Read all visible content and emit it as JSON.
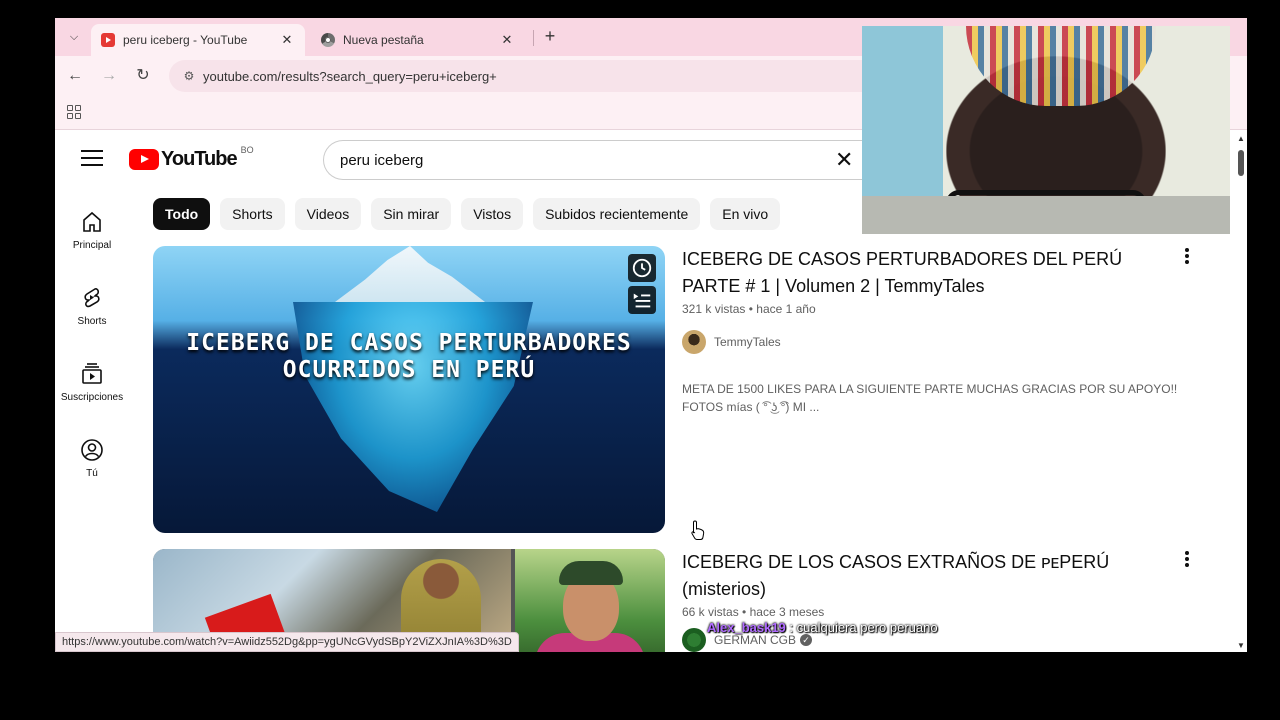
{
  "browser": {
    "tabs": [
      {
        "title": "peru iceberg - YouTube",
        "favicon": "youtube-favicon",
        "active": true
      },
      {
        "title": "Nueva pestaña",
        "favicon": "chrome-favicon",
        "active": false
      }
    ],
    "url": "youtube.com/results?search_query=peru+iceberg+",
    "status_url": "https://www.youtube.com/watch?v=Awiidz552Dg&pp=ygUNcGVydSBpY2ViZXJnIA%3D%3D"
  },
  "youtube": {
    "logo_text": "YouTube",
    "region": "BO",
    "search_value": "peru iceberg",
    "sidebar": [
      {
        "label": "Principal",
        "icon": "home-icon"
      },
      {
        "label": "Shorts",
        "icon": "shorts-icon"
      },
      {
        "label": "Suscripciones",
        "icon": "subscriptions-icon"
      },
      {
        "label": "Tú",
        "icon": "you-icon"
      }
    ],
    "chips": [
      "Todo",
      "Shorts",
      "Videos",
      "Sin mirar",
      "Vistos",
      "Subidos recientemente",
      "En vivo"
    ],
    "results": [
      {
        "title": "ICEBERG DE CASOS PERTURBADORES DEL PERÚ PARTE # 1 | Volumen 2 | TemmyTales",
        "views": "321 k vistas",
        "age": "hace 1 año",
        "channel": "TemmyTales",
        "description": "META DE 1500 LIKES PARA LA SIGUIENTE PARTE MUCHAS GRACIAS POR SU APOYO!! FOTOS mías ( ͡° ͜ʖ ͡°) MI ...",
        "thumbnail_text_line1": "ICEBERG DE CASOS PERTURBADORES",
        "thumbnail_text_line2": "OCURRIDOS EN PERÚ"
      },
      {
        "title": "ICEBERG DE LOS CASOS EXTRAÑOS DE ᴘᴇPERÚ (misterios)",
        "views": "66 k vistas",
        "age": "hace 3 meses",
        "channel": "GERMAN CGB"
      }
    ]
  },
  "overlay": {
    "chat_user": "Alex_bask19",
    "chat_message": ": cualquiera pero peruano"
  },
  "colors": {
    "tabstrip": "#f9d7e3",
    "toolbar": "#fdf0f4",
    "youtube_red": "#ff0000",
    "chip_active": "#0f0f0f"
  }
}
